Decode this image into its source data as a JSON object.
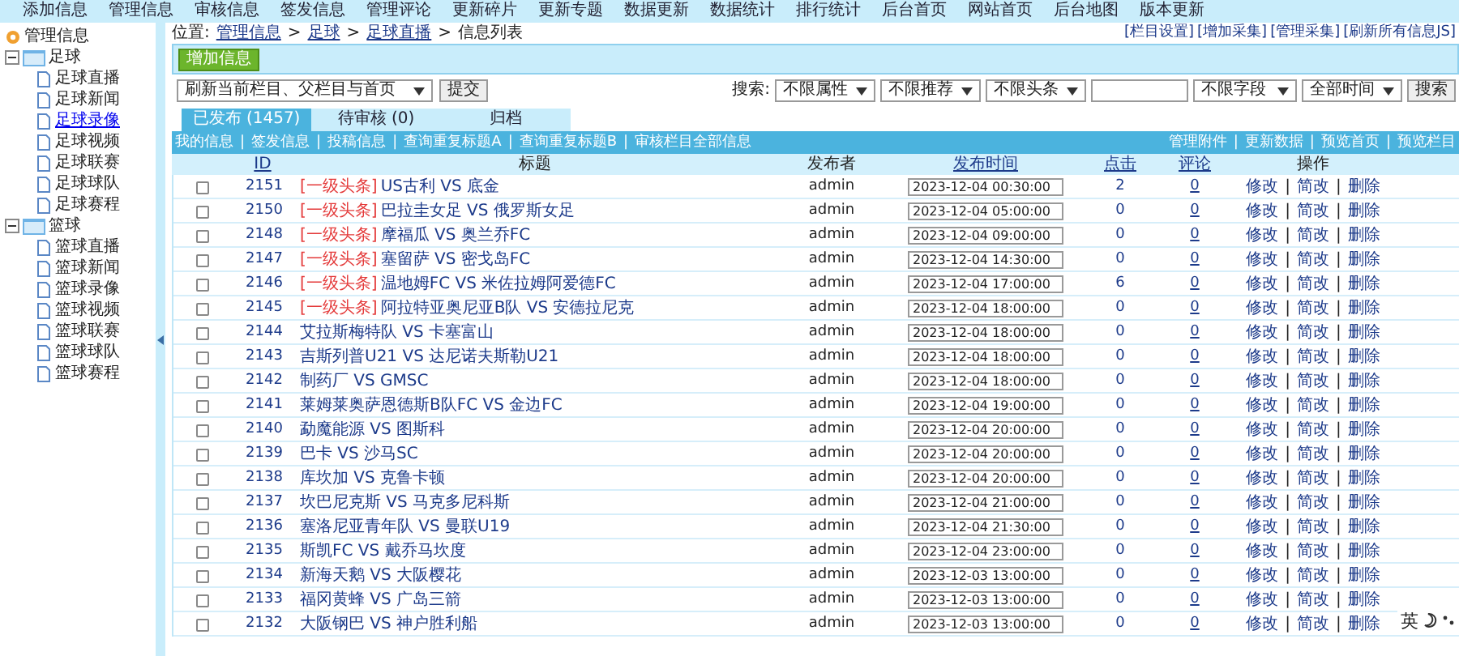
{
  "top_menu": [
    "添加信息",
    "管理信息",
    "审核信息",
    "签发信息",
    "管理评论",
    "更新碎片",
    "更新专题",
    "数据更新",
    "数据统计",
    "排行统计",
    "后台首页",
    "网站首页",
    "后台地图",
    "版本更新"
  ],
  "sidebar": {
    "root": "管理信息",
    "items": [
      {
        "label": "足球",
        "expanded": true,
        "children": [
          {
            "label": "足球直播",
            "selected": false
          },
          {
            "label": "足球新闻",
            "selected": false
          },
          {
            "label": "足球录像",
            "selected": true
          },
          {
            "label": "足球视频",
            "selected": false
          },
          {
            "label": "足球联赛",
            "selected": false
          },
          {
            "label": "足球球队",
            "selected": false
          },
          {
            "label": "足球赛程",
            "selected": false
          }
        ]
      },
      {
        "label": "篮球",
        "expanded": true,
        "children": [
          {
            "label": "篮球直播",
            "selected": false
          },
          {
            "label": "篮球新闻",
            "selected": false
          },
          {
            "label": "篮球录像",
            "selected": false
          },
          {
            "label": "篮球视频",
            "selected": false
          },
          {
            "label": "篮球联赛",
            "selected": false
          },
          {
            "label": "篮球球队",
            "selected": false
          },
          {
            "label": "篮球赛程",
            "selected": false
          }
        ]
      }
    ]
  },
  "breadcrumb": {
    "label": "位置:",
    "separator": ">",
    "items": [
      "管理信息",
      "足球",
      "足球直播"
    ],
    "current": "信息列表"
  },
  "header_links": [
    "[栏目设置]",
    "[增加采集]",
    "[管理采集]",
    "[刷新所有信息JS]"
  ],
  "add_button": "增加信息",
  "refresh": {
    "select": "刷新当前栏目、父栏目与首页",
    "button": "提交"
  },
  "search": {
    "label": "搜索:",
    "filters": [
      "不限属性",
      "不限推荐",
      "不限头条"
    ],
    "field_select": "不限字段",
    "time_select": "全部时间",
    "button": "搜索"
  },
  "tabs": [
    {
      "label": "已发布 (1457)",
      "selected": true
    },
    {
      "label": "待审核 (0)",
      "selected": false
    },
    {
      "label": "归档",
      "selected": false
    }
  ],
  "link_separator": "|",
  "sub_links": [
    "我的信息",
    "签发信息",
    "投稿信息",
    "查询重复标题A",
    "查询重复标题B",
    "审核栏目全部信息"
  ],
  "right_links": [
    "管理附件",
    "更新数据",
    "预览首页",
    "预览栏目"
  ],
  "table": {
    "columns": [
      "ID",
      "标题",
      "发布者",
      "发布时间",
      "点击",
      "评论",
      "操作"
    ],
    "rows": [
      {
        "checked": false,
        "id": "2151",
        "tag": "[一级头条]",
        "title": "US古利 VS 底金",
        "author": "admin",
        "time": "2023-12-04 00:30:00",
        "clicks": "2",
        "comments": "0",
        "actions": [
          "修改",
          "简改",
          "删除"
        ]
      },
      {
        "checked": false,
        "id": "2150",
        "tag": "[一级头条]",
        "title": "巴拉圭女足 VS 俄罗斯女足",
        "author": "admin",
        "time": "2023-12-04 05:00:00",
        "clicks": "0",
        "comments": "0",
        "actions": [
          "修改",
          "简改",
          "删除"
        ]
      },
      {
        "checked": false,
        "id": "2148",
        "tag": "[一级头条]",
        "title": "摩福瓜 VS 奥兰乔FC",
        "author": "admin",
        "time": "2023-12-04 09:00:00",
        "clicks": "0",
        "comments": "0",
        "actions": [
          "修改",
          "简改",
          "删除"
        ]
      },
      {
        "checked": false,
        "id": "2147",
        "tag": "[一级头条]",
        "title": "塞留萨 VS 密戈岛FC",
        "author": "admin",
        "time": "2023-12-04 14:30:00",
        "clicks": "0",
        "comments": "0",
        "actions": [
          "修改",
          "简改",
          "删除"
        ]
      },
      {
        "checked": false,
        "id": "2146",
        "tag": "[一级头条]",
        "title": "温地姆FC VS 米佐拉姆阿爱德FC",
        "author": "admin",
        "time": "2023-12-04 17:00:00",
        "clicks": "6",
        "comments": "0",
        "actions": [
          "修改",
          "简改",
          "删除"
        ]
      },
      {
        "checked": false,
        "id": "2145",
        "tag": "[一级头条]",
        "title": "阿拉特亚奥尼亚B队 VS 安德拉尼克",
        "author": "admin",
        "time": "2023-12-04 18:00:00",
        "clicks": "0",
        "comments": "0",
        "actions": [
          "修改",
          "简改",
          "删除"
        ]
      },
      {
        "checked": false,
        "id": "2144",
        "title": "艾拉斯梅特队 VS 卡塞富山",
        "author": "admin",
        "time": "2023-12-04 18:00:00",
        "clicks": "0",
        "comments": "0",
        "actions": [
          "修改",
          "简改",
          "删除"
        ]
      },
      {
        "checked": false,
        "id": "2143",
        "title": "吉斯列普U21 VS 达尼诺夫斯勒U21",
        "author": "admin",
        "time": "2023-12-04 18:00:00",
        "clicks": "0",
        "comments": "0",
        "actions": [
          "修改",
          "简改",
          "删除"
        ]
      },
      {
        "checked": false,
        "id": "2142",
        "title": "制药厂 VS GMSC",
        "author": "admin",
        "time": "2023-12-04 18:00:00",
        "clicks": "0",
        "comments": "0",
        "actions": [
          "修改",
          "简改",
          "删除"
        ]
      },
      {
        "checked": false,
        "id": "2141",
        "title": "莱姆莱奥萨恩德斯B队FC VS 金边FC",
        "author": "admin",
        "time": "2023-12-04 19:00:00",
        "clicks": "0",
        "comments": "0",
        "actions": [
          "修改",
          "简改",
          "删除"
        ]
      },
      {
        "checked": false,
        "id": "2140",
        "title": "勐魔能源 VS 图斯科",
        "author": "admin",
        "time": "2023-12-04 20:00:00",
        "clicks": "0",
        "comments": "0",
        "actions": [
          "修改",
          "简改",
          "删除"
        ]
      },
      {
        "checked": false,
        "id": "2139",
        "title": "巴卡 VS 沙马SC",
        "author": "admin",
        "time": "2023-12-04 20:00:00",
        "clicks": "0",
        "comments": "0",
        "actions": [
          "修改",
          "简改",
          "删除"
        ]
      },
      {
        "checked": false,
        "id": "2138",
        "title": "库坎加 VS 克鲁卡顿",
        "author": "admin",
        "time": "2023-12-04 20:00:00",
        "clicks": "0",
        "comments": "0",
        "actions": [
          "修改",
          "简改",
          "删除"
        ]
      },
      {
        "checked": false,
        "id": "2137",
        "title": "坎巴尼克斯 VS 马克多尼科斯",
        "author": "admin",
        "time": "2023-12-04 21:00:00",
        "clicks": "0",
        "comments": "0",
        "actions": [
          "修改",
          "简改",
          "删除"
        ]
      },
      {
        "checked": false,
        "id": "2136",
        "title": "塞洛尼亚青年队 VS 曼联U19",
        "author": "admin",
        "time": "2023-12-04 21:30:00",
        "clicks": "0",
        "comments": "0",
        "actions": [
          "修改",
          "简改",
          "删除"
        ]
      },
      {
        "checked": false,
        "id": "2135",
        "title": "斯凯FC VS 戴乔马坎度",
        "author": "admin",
        "time": "2023-12-04 23:00:00",
        "clicks": "0",
        "comments": "0",
        "actions": [
          "修改",
          "简改",
          "删除"
        ]
      },
      {
        "checked": false,
        "id": "2134",
        "title": "新海天鹅 VS 大阪樱花",
        "author": "admin",
        "time": "2023-12-03 13:00:00",
        "clicks": "0",
        "comments": "0",
        "actions": [
          "修改",
          "简改",
          "删除"
        ]
      },
      {
        "checked": false,
        "id": "2133",
        "title": "福冈黄蜂 VS 广岛三箭",
        "author": "admin",
        "time": "2023-12-03 13:00:00",
        "clicks": "0",
        "comments": "0",
        "actions": [
          "修改",
          "简改",
          "删除"
        ]
      },
      {
        "checked": false,
        "id": "2132",
        "title": "大阪钢巴 VS 神户胜利船",
        "author": "admin",
        "time": "2023-12-03 13:00:00",
        "clicks": "0",
        "comments": "0",
        "actions": [
          "修改",
          "简改",
          "删除"
        ]
      }
    ]
  },
  "ime": {
    "label": "英"
  }
}
